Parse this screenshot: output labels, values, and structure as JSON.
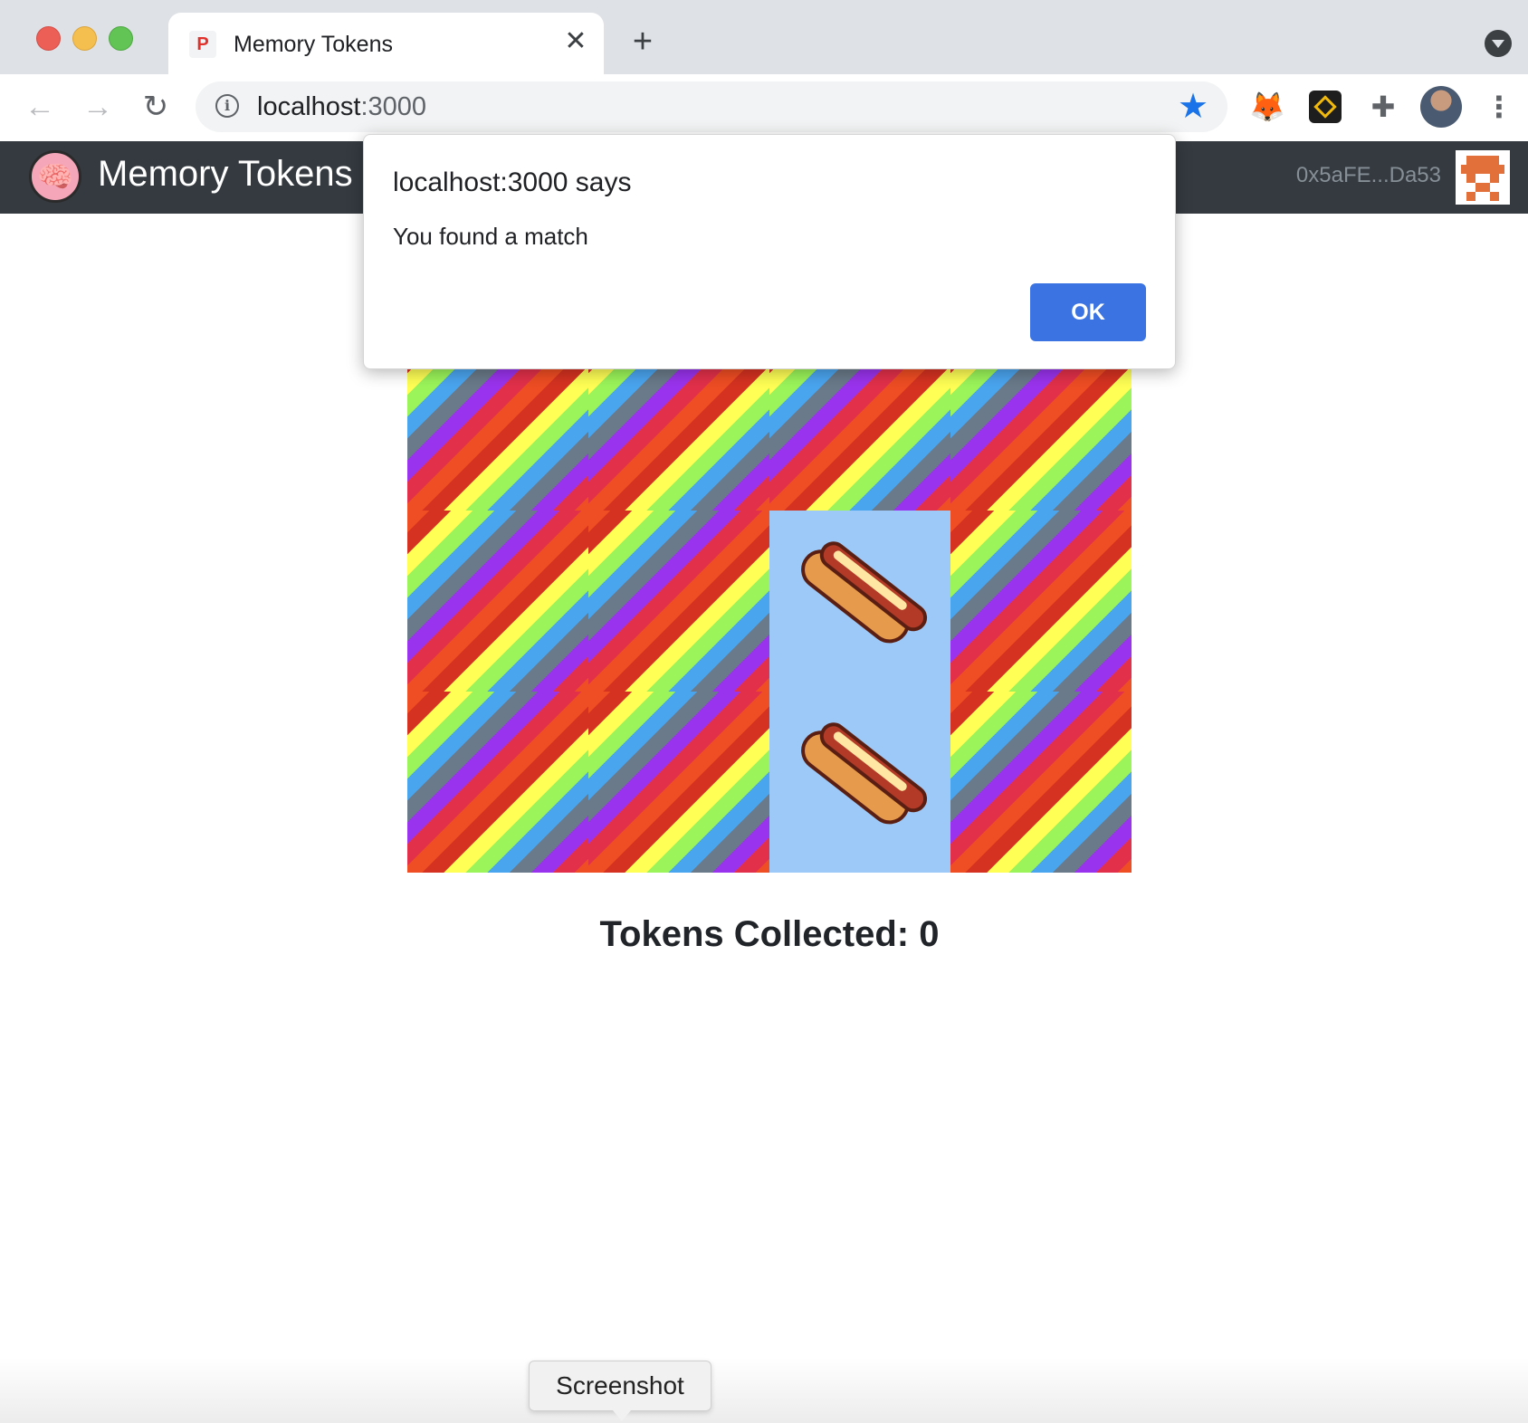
{
  "browser": {
    "tab_title": "Memory Tokens",
    "tab_favicon": "P",
    "close_glyph": "✕",
    "new_tab_glyph": "+",
    "url_host": "localhost",
    "url_port": ":3000",
    "back_glyph": "←",
    "forward_glyph": "→",
    "reload_glyph": "↻",
    "info_glyph": "i",
    "star_glyph": "★",
    "fox_glyph": "🦊",
    "puzzle_glyph": "✚",
    "menu_glyph": "⋮",
    "icons": [
      "back-icon",
      "forward-icon",
      "reload-icon",
      "site-info-icon",
      "bookmark-star-icon",
      "metamask-fox-icon",
      "binance-wallet-icon",
      "extensions-puzzle-icon",
      "profile-avatar",
      "chrome-menu-icon"
    ]
  },
  "app": {
    "brand_icon": "🧠",
    "brand": "Memory Tokens",
    "account": "0x5aFE...Da53",
    "tokens_collected": "Tokens Collected: 0"
  },
  "board": {
    "rows": 3,
    "columns": 4,
    "revealed_cells": [
      [
        1,
        2
      ],
      [
        2,
        2
      ]
    ],
    "revealed_card": "hotdog"
  },
  "dialog": {
    "title": "localhost:3000 says",
    "message": "You found a match",
    "ok_label": "OK"
  },
  "tooltip": {
    "label": "Screenshot"
  },
  "colors": {
    "navbar": "#343a40",
    "ok_button": "#3b74e2",
    "card_back_bg": "#9dc9f8",
    "bookmark_star": "#1a73e8"
  }
}
